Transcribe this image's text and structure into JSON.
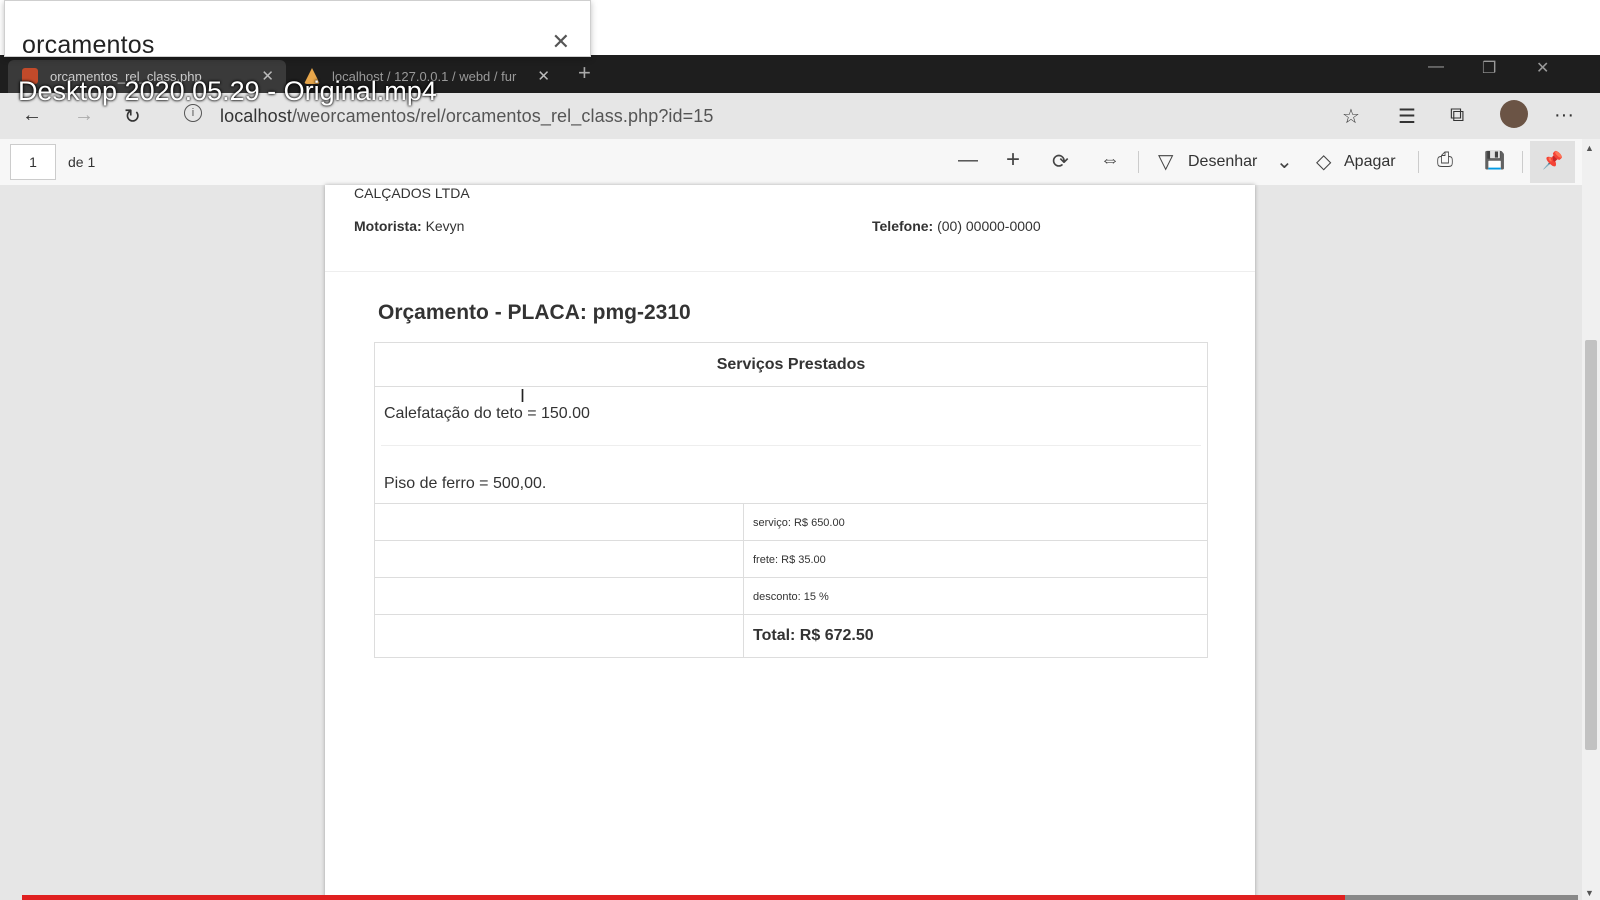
{
  "popup": {
    "title": "orcamentos",
    "close_glyph": "✕"
  },
  "watermark": "Desktop 2020.05.29 - Original.mp4",
  "tabs": [
    {
      "label": "orcamentos_rel_class.php",
      "close_glyph": "✕"
    },
    {
      "label": "localhost / 127.0.0.1 / webd / fur",
      "close_glyph": "✕"
    }
  ],
  "new_tab_glyph": "+",
  "window_controls": {
    "minimize": "—",
    "restore": "❐",
    "close": "✕"
  },
  "address": {
    "host": "localhost",
    "path": "/weorcamentos/rel/orcamentos_rel_class.php?id=15",
    "back": "←",
    "forward": "→",
    "reload": "↻",
    "info": "i",
    "star": "☆",
    "favorites": "☰",
    "collections": "⧉",
    "more": "···"
  },
  "pdf_toolbar": {
    "page_number": "1",
    "page_of": "de 1",
    "zoom_out": "—",
    "zoom_in": "+",
    "rotate": "⟳",
    "fit": "⇔",
    "draw_icon": "▽",
    "draw_label": "Desenhar",
    "draw_dropdown": "⌄",
    "erase_icon": "◇",
    "erase_label": "Apagar",
    "print": "⎙",
    "save": "💾",
    "pin": "📌"
  },
  "document": {
    "company": "CALÇADOS LTDA",
    "driver_label": "Motorista:",
    "driver_value": "Kevyn",
    "phone_label": "Telefone:",
    "phone_value": "(00) 00000-0000",
    "title": "Orçamento - PLACA: pmg-2310",
    "services_header": "Serviços Prestados",
    "services": [
      "Calefatação do teto = 150.00",
      "Piso de ferro = 500,00."
    ],
    "summary": {
      "service": "serviço: R$ 650.00",
      "freight": "frete: R$ 35.00",
      "discount": "desconto: 15 %",
      "total": "Total: R$ 672.50"
    }
  },
  "text_cursor": "I",
  "video_progress": 0.85,
  "colors": {
    "progress": "#e02020",
    "tabbar": "#1e1e1e"
  }
}
